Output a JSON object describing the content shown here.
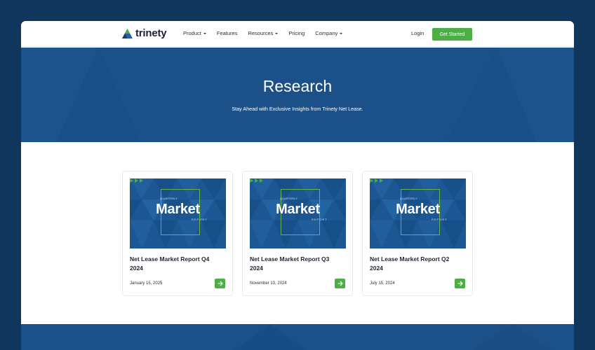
{
  "brand": {
    "name": "trinety",
    "icon": "trinety-triangle-logo"
  },
  "nav": {
    "items": [
      {
        "label": "Product",
        "dropdown": true
      },
      {
        "label": "Features",
        "dropdown": false
      },
      {
        "label": "Resources",
        "dropdown": true
      },
      {
        "label": "Pricing",
        "dropdown": false
      },
      {
        "label": "Company",
        "dropdown": true
      }
    ],
    "login": "Login",
    "cta": "Get Started"
  },
  "hero": {
    "title": "Research",
    "subtitle": "Stay Ahead with Exclusive Insights from Trinety Net Lease."
  },
  "thumbnail": {
    "kicker": "QUARTERLY",
    "headline": "Market",
    "tag": "REPORT"
  },
  "cards": [
    {
      "title": "Net Lease Market Report Q4 2024",
      "date": "January 15, 2025",
      "action_icon": "arrow-right-icon"
    },
    {
      "title": "Net Lease Market Report Q3 2024",
      "date": "November 13, 2024",
      "action_icon": "arrow-right-icon"
    },
    {
      "title": "Net Lease Market Report Q2 2024",
      "date": "July 15, 2024",
      "action_icon": "arrow-right-icon"
    }
  ],
  "colors": {
    "page_bg": "#11365e",
    "hero_bg": "#1b5089",
    "accent": "#4caf45",
    "text_dark": "#1f2530"
  }
}
